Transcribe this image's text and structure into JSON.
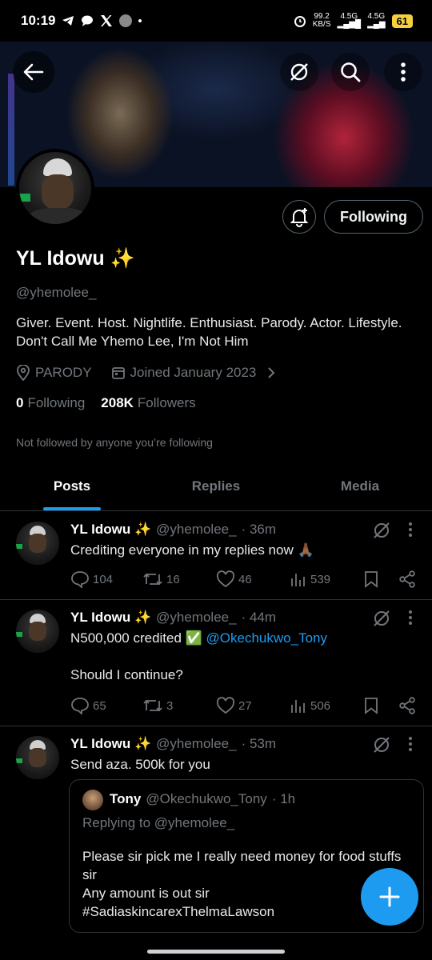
{
  "status_bar": {
    "time": "10:19",
    "net_speed_top": "99.2",
    "net_speed_unit": "KB/S",
    "signal1": "4.5G",
    "signal2": "4.5G",
    "battery": "61"
  },
  "profile": {
    "name": "YL Idowu ✨",
    "handle": "@yhemolee_",
    "bio": "Giver. Event. Host. Nightlife. Enthusiast. Parody. Actor. Lifestyle. Don't Call Me Yhemo Lee, I'm Not Him",
    "location": "PARODY",
    "joined": "Joined January 2023",
    "following_count": "0",
    "following_label": "Following",
    "followers_count": "208K",
    "followers_label": "Followers",
    "not_followed_text": "Not followed by anyone you’re following",
    "following_button": "Following"
  },
  "tabs": [
    {
      "label": "Posts",
      "active": true
    },
    {
      "label": "Replies",
      "active": false
    },
    {
      "label": "Media",
      "active": false
    }
  ],
  "posts": [
    {
      "name": "YL Idowu ✨",
      "handle": "@yhemolee_",
      "time": "· 36m",
      "text": "Crediting everyone in my replies now 🙏🏾",
      "replies": "104",
      "reposts": "16",
      "likes": "46",
      "views": "539"
    },
    {
      "name": "YL Idowu ✨",
      "handle": "@yhemolee_",
      "time": "· 44m",
      "text_pre": "N500,000 credited ✅ ",
      "mention": "@Okechukwo_Tony",
      "text_second": "Should I continue?",
      "replies": "65",
      "reposts": "3",
      "likes": "27",
      "views": "506"
    },
    {
      "name": "YL Idowu ✨",
      "handle": "@yhemolee_",
      "time": "· 53m",
      "text": "Send aza. 500k for you",
      "quote": {
        "name": "Tony",
        "handle": "@Okechukwo_Tony",
        "time": "· 1h",
        "replying_to": "Replying to @yhemolee_",
        "line1": "Please sir pick me I really need money for food stuffs sir",
        "line2": "Any amount is out sir",
        "line3": "#SadiaskincarexThelmaLawson"
      }
    }
  ],
  "colors": {
    "accent": "#1d9bf0",
    "muted": "#71767b",
    "divider": "#2f3336"
  }
}
